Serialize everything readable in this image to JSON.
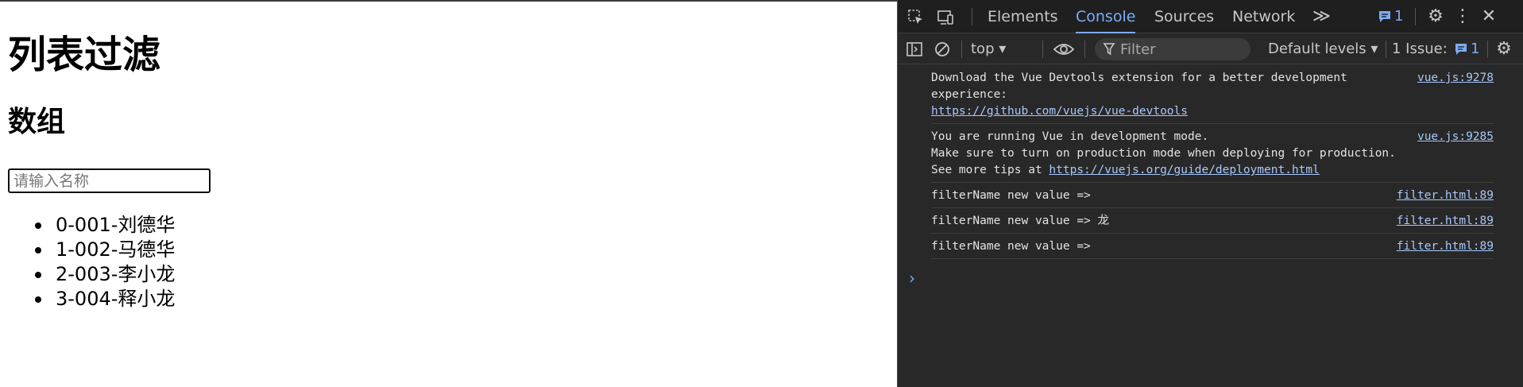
{
  "page": {
    "title": "列表过滤",
    "subtitle": "数组",
    "search": {
      "placeholder": "请输入名称",
      "value": ""
    },
    "items": [
      "0-001-刘德华",
      "1-002-马德华",
      "2-003-李小龙",
      "3-004-释小龙"
    ]
  },
  "devtools": {
    "tabs": [
      "Elements",
      "Console",
      "Sources",
      "Network"
    ],
    "active_tab": "Console",
    "more_tabs_glyph": "≫",
    "message_badge": "1",
    "toolbar": {
      "context": "top",
      "filter_placeholder": "Filter",
      "levels": "Default levels",
      "issues_label": "1 Issue:",
      "issues_count": "1"
    },
    "messages": [
      {
        "lines": [
          "Download the Vue Devtools extension for a better development",
          "experience:"
        ],
        "link": "https://github.com/vuejs/vue-devtools",
        "source": "vue.js:9278"
      },
      {
        "lines": [
          "You are running Vue in development mode.",
          "Make sure to turn on production mode when deploying for production."
        ],
        "link_prefix": "See more tips at ",
        "link": "https://vuejs.org/guide/deployment.html",
        "source": "vue.js:9285"
      },
      {
        "lines": [
          "filterName new value =>"
        ],
        "source": "filter.html:89"
      },
      {
        "lines": [
          "filterName new value => 龙"
        ],
        "source": "filter.html:89"
      },
      {
        "lines": [
          "filterName new value =>"
        ],
        "source": "filter.html:89"
      }
    ],
    "accent_color": "#7cacf8",
    "link_color": "#a8c7fa"
  }
}
